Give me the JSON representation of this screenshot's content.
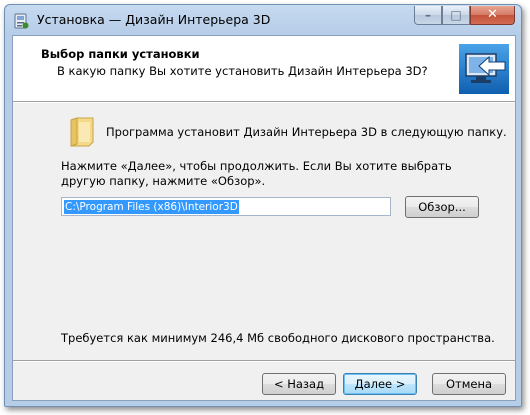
{
  "window": {
    "title": "Установка — Дизайн Интерьера 3D",
    "minimize_glyph": "–",
    "maximize_glyph": "□",
    "close_glyph": "✕"
  },
  "header": {
    "title": "Выбор папки установки",
    "subtitle": "В какую папку Вы хотите установить Дизайн Интерьера 3D?"
  },
  "body": {
    "intro": "Программа установит Дизайн Интерьера 3D в следующую папку.",
    "hint": "Нажмите «Далее», чтобы продолжить. Если Вы хотите выбрать другую папку, нажмите «Обзор».",
    "path_value": "C:\\Program Files (x86)\\Interior3D",
    "browse_label": "Обзор...",
    "space_required": "Требуется как минимум 246,4 Мб свободного дискового пространства."
  },
  "footer": {
    "back_label": "< Назад",
    "next_label": "Далее >",
    "cancel_label": "Отмена"
  },
  "icons": {
    "app": "installer-icon",
    "folder": "folder-icon",
    "header_logo": "computer-install-arrow-icon"
  },
  "colors": {
    "title_bar": "#b6cde8",
    "selection": "#3399ff",
    "close_button": "#c3523a"
  }
}
